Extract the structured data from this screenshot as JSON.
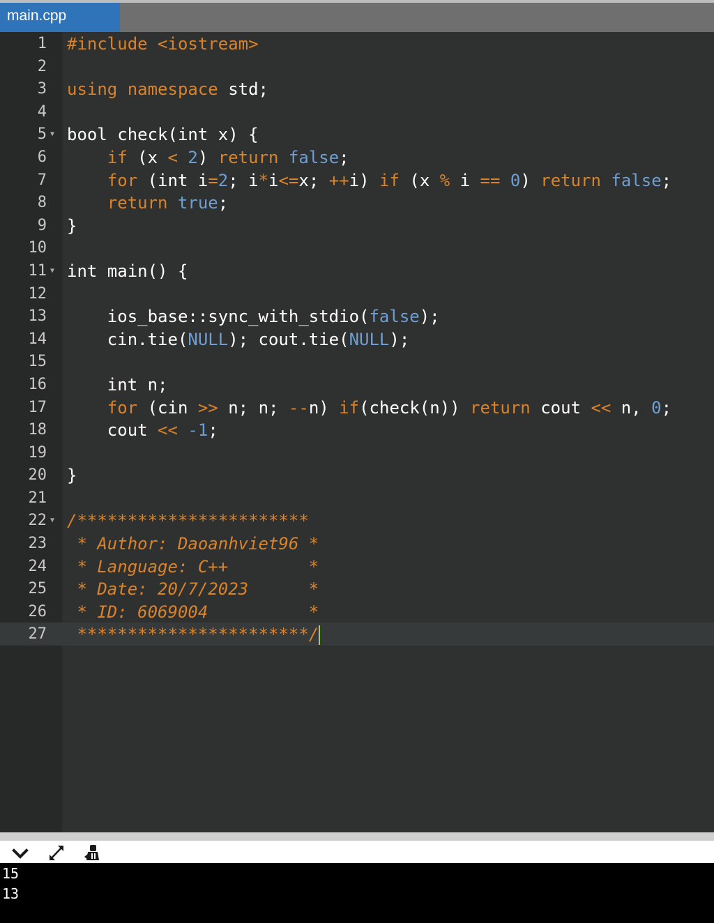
{
  "tab": {
    "label": "main.cpp"
  },
  "editor": {
    "lines": [
      {
        "n": "1"
      },
      {
        "n": "2"
      },
      {
        "n": "3"
      },
      {
        "n": "4"
      },
      {
        "n": "5"
      },
      {
        "n": "6"
      },
      {
        "n": "7"
      },
      {
        "n": "8"
      },
      {
        "n": "9"
      },
      {
        "n": "10"
      },
      {
        "n": "11"
      },
      {
        "n": "12"
      },
      {
        "n": "13"
      },
      {
        "n": "14"
      },
      {
        "n": "15"
      },
      {
        "n": "16"
      },
      {
        "n": "17"
      },
      {
        "n": "18"
      },
      {
        "n": "19"
      },
      {
        "n": "20"
      },
      {
        "n": "21"
      },
      {
        "n": "22"
      },
      {
        "n": "23"
      },
      {
        "n": "24"
      },
      {
        "n": "25"
      },
      {
        "n": "26"
      },
      {
        "n": "27"
      }
    ],
    "code": {
      "include_kw": "#include",
      "include_hdr": "<iostream>",
      "using": "using",
      "namespace": "namespace",
      "std": " std;",
      "l5": "bool check(int x) {",
      "if": "if",
      "x_open": " (x ",
      "lt": "<",
      "two": "2",
      "close_paren": ")",
      "return": "return",
      "false": "false",
      "semi": ";",
      "for": "for",
      "int_i": " (int i",
      "eq": "=",
      "i_mul": "; i",
      "star": "*",
      "i_le": "i",
      "le": "<=",
      "x_semi": "x; ",
      "pp": "++",
      "i_close": "i) ",
      "x_paren": " (x ",
      "pct": "%",
      "i_sp": " i ",
      "eqeq": "==",
      "zero": "0",
      "true": "true",
      "close_brace": "}",
      "l11": "int main() {",
      "ios": "ios_base::sync_with_stdio(",
      "close_semi": ");",
      "cin_tie": "cin.tie(",
      "null": "NULL",
      "cout_tie": "); cout.tie(",
      "int_n": "int n;",
      "cin_open": " (cin ",
      "shr": ">>",
      "n_semi": " n; n; ",
      "mm": "--",
      "n_close": "n) ",
      "check_n": "(check(n)) ",
      "cout_sp": " cout ",
      "shl": "<<",
      "n_comma": " n, ",
      "cout": "cout ",
      "minus_one": "-1",
      "c22": "/***********************",
      "c23": " * Author: Daoanhviet96 *",
      "c24": " * Language: C++        *",
      "c25": " * Date: 20/7/2023      *",
      "c26": " * ID: 6069004          *",
      "c27": " ***********************/"
    }
  },
  "console": {
    "lines": [
      "15",
      "13"
    ]
  },
  "icons": {
    "collapse": "chevron-down-icon",
    "expand": "expand-arrows-icon",
    "clear": "clear-console-icon"
  },
  "colors": {
    "tab_active": "#2f73b9",
    "keyword": "#d9832a",
    "constant": "#6f9fd2",
    "editor_bg": "#2f3030",
    "gutter_bg": "#272828"
  }
}
